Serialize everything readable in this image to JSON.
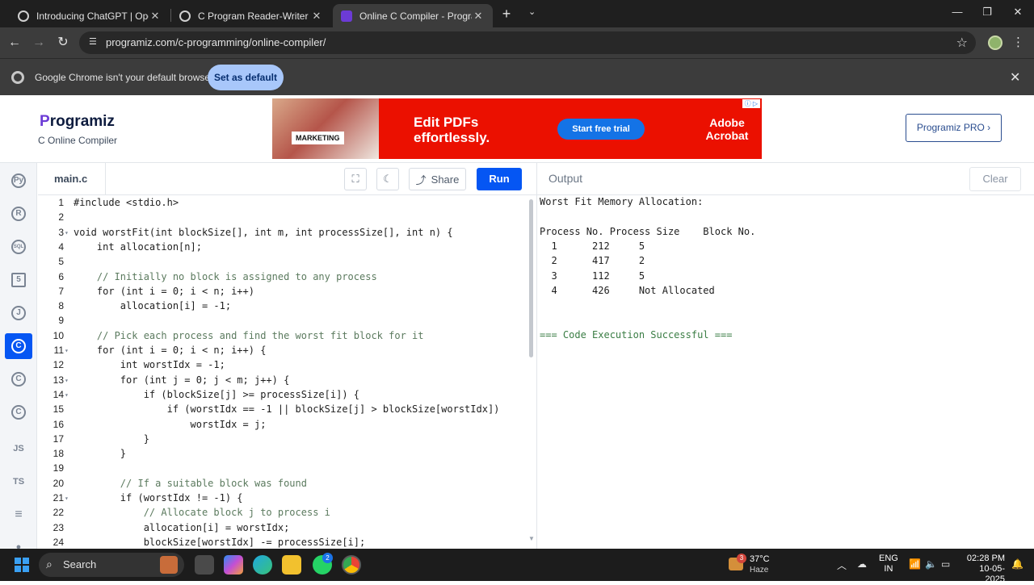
{
  "browser": {
    "tabs": [
      {
        "title": "Introducing ChatGPT | OpenAI",
        "active": false,
        "favicon": "openai-icon"
      },
      {
        "title": "C Program Reader-Writer Sema",
        "active": false,
        "favicon": "openai-icon"
      },
      {
        "title": "Online C Compiler - Programiz",
        "active": true,
        "favicon": "programiz-icon"
      }
    ],
    "url": "programiz.com/c-programming/online-compiler/",
    "infobar_message": "Google Chrome isn't your default browser",
    "infobar_button": "Set as default"
  },
  "site": {
    "logo_text": "rogramiz",
    "logo_initial": "P",
    "subtitle": "C Online Compiler",
    "pro_button": "Programiz PRO ›",
    "ad": {
      "badge": "MARKETING",
      "headline": "Edit PDFs effortlessly.",
      "cta": "Start free trial",
      "brand": "Adobe Acrobat"
    }
  },
  "rail": {
    "items": [
      {
        "name": "python",
        "label": "Py"
      },
      {
        "name": "r",
        "label": "R"
      },
      {
        "name": "sql",
        "label": "SQL"
      },
      {
        "name": "html",
        "label": "5"
      },
      {
        "name": "java",
        "label": "J"
      },
      {
        "name": "c",
        "label": "C",
        "active": true
      },
      {
        "name": "cpp",
        "label": "C"
      },
      {
        "name": "csharp",
        "label": "C"
      },
      {
        "name": "javascript",
        "label": "JS"
      },
      {
        "name": "typescript",
        "label": "TS"
      },
      {
        "name": "go",
        "label": "≡"
      },
      {
        "name": "more",
        "label": "●"
      }
    ]
  },
  "editor": {
    "filename": "main.c",
    "share_label": "Share",
    "run_label": "Run",
    "lines": [
      {
        "n": "1",
        "fold": false,
        "text": "#include <stdio.h>"
      },
      {
        "n": "2",
        "fold": false,
        "text": ""
      },
      {
        "n": "3",
        "fold": true,
        "text": "void worstFit(int blockSize[], int m, int processSize[], int n) {"
      },
      {
        "n": "4",
        "fold": false,
        "text": "    int allocation[n];"
      },
      {
        "n": "5",
        "fold": false,
        "text": ""
      },
      {
        "n": "6",
        "fold": false,
        "text": "    // Initially no block is assigned to any process"
      },
      {
        "n": "7",
        "fold": false,
        "text": "    for (int i = 0; i < n; i++)"
      },
      {
        "n": "8",
        "fold": false,
        "text": "        allocation[i] = -1;"
      },
      {
        "n": "9",
        "fold": false,
        "text": ""
      },
      {
        "n": "10",
        "fold": false,
        "text": "    // Pick each process and find the worst fit block for it"
      },
      {
        "n": "11",
        "fold": true,
        "text": "    for (int i = 0; i < n; i++) {"
      },
      {
        "n": "12",
        "fold": false,
        "text": "        int worstIdx = -1;"
      },
      {
        "n": "13",
        "fold": true,
        "text": "        for (int j = 0; j < m; j++) {"
      },
      {
        "n": "14",
        "fold": true,
        "text": "            if (blockSize[j] >= processSize[i]) {"
      },
      {
        "n": "15",
        "fold": false,
        "text": "                if (worstIdx == -1 || blockSize[j] > blockSize[worstIdx])"
      },
      {
        "n": "16",
        "fold": false,
        "text": "                    worstIdx = j;"
      },
      {
        "n": "17",
        "fold": false,
        "text": "            }"
      },
      {
        "n": "18",
        "fold": false,
        "text": "        }"
      },
      {
        "n": "19",
        "fold": false,
        "text": ""
      },
      {
        "n": "20",
        "fold": false,
        "text": "        // If a suitable block was found"
      },
      {
        "n": "21",
        "fold": true,
        "text": "        if (worstIdx != -1) {"
      },
      {
        "n": "22",
        "fold": false,
        "text": "            // Allocate block j to process i"
      },
      {
        "n": "23",
        "fold": false,
        "text": "            allocation[i] = worstIdx;"
      },
      {
        "n": "24",
        "fold": false,
        "text": "            blockSize[worstIdx] -= processSize[i];"
      }
    ]
  },
  "output": {
    "title": "Output",
    "clear_label": "Clear",
    "lines": [
      "Worst Fit Memory Allocation:",
      "",
      "Process No. Process Size    Block No.",
      "  1      212     5",
      "  2      417     2",
      "  3      112     5",
      "  4      426     Not Allocated",
      "",
      "",
      "=== Code Execution Successful ==="
    ]
  },
  "taskbar": {
    "search_label": "Search",
    "weather_temp": "37°C",
    "weather_cond": "Haze",
    "weather_badge": "3",
    "whatsapp_badge": "2",
    "lang_top": "ENG",
    "lang_bottom": "IN",
    "time": "02:28 PM",
    "date": "10-05-2025"
  },
  "colors": {
    "accent": "#0556f3",
    "ad_red": "#eb1000",
    "success_green": "#3a7d44"
  }
}
